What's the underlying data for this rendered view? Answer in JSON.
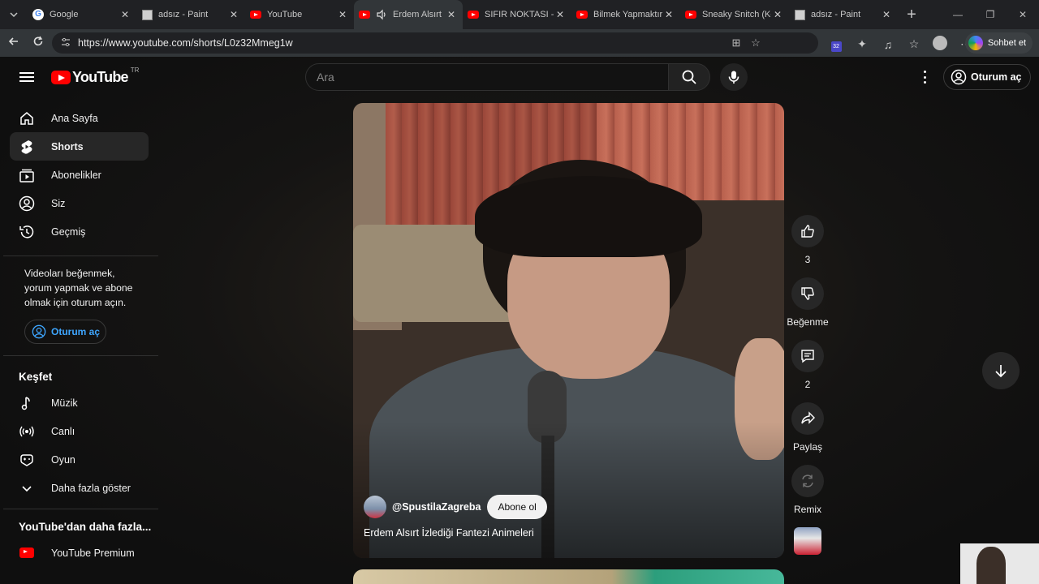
{
  "browser": {
    "tabs": [
      {
        "title": "Google",
        "favicon": "google-icon",
        "active": false
      },
      {
        "title": "adsız - Paint",
        "favicon": "paint-icon",
        "active": false
      },
      {
        "title": "YouTube",
        "favicon": "youtube-icon",
        "active": false
      },
      {
        "title": "Erdem Alsırt İz",
        "favicon": "youtube-icon",
        "active": true,
        "audio": true
      },
      {
        "title": "SIFIR NOKTASI - Kı",
        "favicon": "youtube-icon",
        "active": false
      },
      {
        "title": "Bilmek Yapmaktır -",
        "favicon": "youtube-icon",
        "active": false
      },
      {
        "title": "Sneaky Snitch (Kevi",
        "favicon": "youtube-icon",
        "active": false
      },
      {
        "title": "adsız - Paint",
        "favicon": "paint-icon",
        "active": false
      }
    ],
    "url": "https://www.youtube.com/shorts/L0z32Mmeg1w",
    "copilot_label": "Sohbet et",
    "ext_badge": "32"
  },
  "header": {
    "logo_text": "YouTube",
    "country_code": "TR",
    "search_placeholder": "Ara",
    "signin_label": "Oturum aç"
  },
  "sidebar": {
    "main": [
      {
        "label": "Ana Sayfa",
        "icon": "home-icon"
      },
      {
        "label": "Shorts",
        "icon": "shorts-icon",
        "active": true
      },
      {
        "label": "Abonelikler",
        "icon": "subscriptions-icon"
      },
      {
        "label": "Siz",
        "icon": "user-icon"
      },
      {
        "label": "Geçmiş",
        "icon": "history-icon"
      }
    ],
    "signin_message": "Videoları beğenmek, yorum yapmak ve abone olmak için oturum açın.",
    "signin_button": "Oturum aç",
    "explore_title": "Keşfet",
    "explore": [
      {
        "label": "Müzik",
        "icon": "music-icon"
      },
      {
        "label": "Canlı",
        "icon": "live-icon"
      },
      {
        "label": "Oyun",
        "icon": "gaming-icon"
      },
      {
        "label": "Daha fazla göster",
        "icon": "chevron-down-icon"
      }
    ],
    "more_title": "YouTube'dan daha fazla...",
    "more": [
      {
        "label": "YouTube Premium",
        "icon": "youtube-premium-icon"
      }
    ]
  },
  "short": {
    "channel": "@SpustilaZagreba",
    "subscribe_label": "Abone ol",
    "title": "Erdem Alsırt İzlediği Fantezi Animeleri"
  },
  "actions": {
    "like_count": "3",
    "dislike_label": "Beğenme",
    "comment_count": "2",
    "share_label": "Paylaş",
    "remix_label": "Remix"
  },
  "colors": {
    "accent_red": "#ff0000",
    "link_blue": "#3ea6ff",
    "background": "#0f0f0f"
  }
}
